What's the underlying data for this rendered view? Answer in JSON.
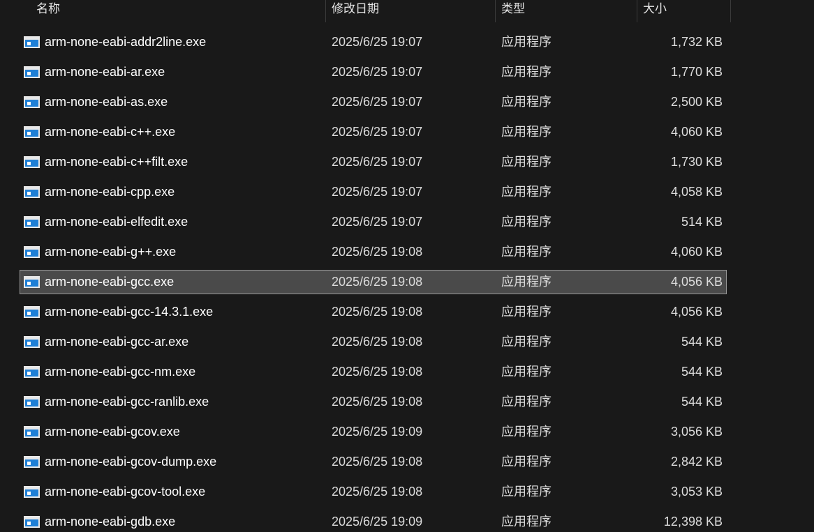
{
  "columns": {
    "name": "名称",
    "date": "修改日期",
    "type": "类型",
    "size": "大小"
  },
  "icon": "exe-application-icon",
  "files": [
    {
      "name": "arm-none-eabi-addr2line.exe",
      "date": "2025/6/25 19:07",
      "type": "应用程序",
      "size": "1,732 KB",
      "selected": false
    },
    {
      "name": "arm-none-eabi-ar.exe",
      "date": "2025/6/25 19:07",
      "type": "应用程序",
      "size": "1,770 KB",
      "selected": false
    },
    {
      "name": "arm-none-eabi-as.exe",
      "date": "2025/6/25 19:07",
      "type": "应用程序",
      "size": "2,500 KB",
      "selected": false
    },
    {
      "name": "arm-none-eabi-c++.exe",
      "date": "2025/6/25 19:07",
      "type": "应用程序",
      "size": "4,060 KB",
      "selected": false
    },
    {
      "name": "arm-none-eabi-c++filt.exe",
      "date": "2025/6/25 19:07",
      "type": "应用程序",
      "size": "1,730 KB",
      "selected": false
    },
    {
      "name": "arm-none-eabi-cpp.exe",
      "date": "2025/6/25 19:07",
      "type": "应用程序",
      "size": "4,058 KB",
      "selected": false
    },
    {
      "name": "arm-none-eabi-elfedit.exe",
      "date": "2025/6/25 19:07",
      "type": "应用程序",
      "size": "514 KB",
      "selected": false
    },
    {
      "name": "arm-none-eabi-g++.exe",
      "date": "2025/6/25 19:08",
      "type": "应用程序",
      "size": "4,060 KB",
      "selected": false
    },
    {
      "name": "arm-none-eabi-gcc.exe",
      "date": "2025/6/25 19:08",
      "type": "应用程序",
      "size": "4,056 KB",
      "selected": true
    },
    {
      "name": "arm-none-eabi-gcc-14.3.1.exe",
      "date": "2025/6/25 19:08",
      "type": "应用程序",
      "size": "4,056 KB",
      "selected": false
    },
    {
      "name": "arm-none-eabi-gcc-ar.exe",
      "date": "2025/6/25 19:08",
      "type": "应用程序",
      "size": "544 KB",
      "selected": false
    },
    {
      "name": "arm-none-eabi-gcc-nm.exe",
      "date": "2025/6/25 19:08",
      "type": "应用程序",
      "size": "544 KB",
      "selected": false
    },
    {
      "name": "arm-none-eabi-gcc-ranlib.exe",
      "date": "2025/6/25 19:08",
      "type": "应用程序",
      "size": "544 KB",
      "selected": false
    },
    {
      "name": "arm-none-eabi-gcov.exe",
      "date": "2025/6/25 19:09",
      "type": "应用程序",
      "size": "3,056 KB",
      "selected": false
    },
    {
      "name": "arm-none-eabi-gcov-dump.exe",
      "date": "2025/6/25 19:08",
      "type": "应用程序",
      "size": "2,842 KB",
      "selected": false
    },
    {
      "name": "arm-none-eabi-gcov-tool.exe",
      "date": "2025/6/25 19:08",
      "type": "应用程序",
      "size": "3,053 KB",
      "selected": false
    },
    {
      "name": "arm-none-eabi-gdb.exe",
      "date": "2025/6/25 19:09",
      "type": "应用程序",
      "size": "12,398 KB",
      "selected": false
    }
  ]
}
